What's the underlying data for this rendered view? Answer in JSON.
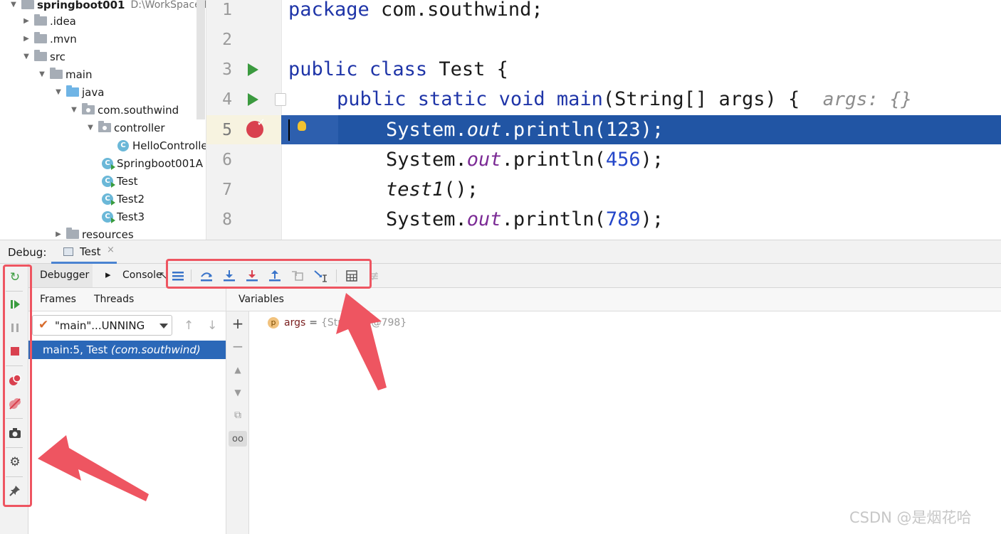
{
  "project": {
    "root_label": "springboot001",
    "root_path": "D:\\WorkSpace\\Id",
    "items": [
      {
        "label": ".idea",
        "kind": "folder"
      },
      {
        "label": ".mvn",
        "kind": "folder"
      },
      {
        "label": "src",
        "kind": "folder"
      },
      {
        "label": "main",
        "kind": "folder"
      },
      {
        "label": "java",
        "kind": "source-folder"
      },
      {
        "label": "com.southwind",
        "kind": "package"
      },
      {
        "label": "controller",
        "kind": "package"
      },
      {
        "label": "HelloControlle",
        "kind": "class"
      },
      {
        "label": "Springboot001A",
        "kind": "class"
      },
      {
        "label": "Test",
        "kind": "class"
      },
      {
        "label": "Test2",
        "kind": "class"
      },
      {
        "label": "Test3",
        "kind": "class"
      },
      {
        "label": "resources",
        "kind": "folder"
      }
    ]
  },
  "editor": {
    "line_numbers": [
      "1",
      "2",
      "3",
      "4",
      "5",
      "6",
      "7",
      "8"
    ],
    "line1": {
      "kw": "package",
      "rest": " com.southwind;"
    },
    "line3": {
      "kw1": "public",
      "kw2": "class",
      "rest": " Test {"
    },
    "line4": {
      "kw": "public static void",
      "name": " main",
      "rest": "(String[] args) {",
      "hint": "args: {}"
    },
    "line5": {
      "pre": "System.",
      "field": "out",
      "call": ".println(",
      "num": "123",
      "post": ");"
    },
    "line6": {
      "pre": "System.",
      "field": "out",
      "call": ".println(",
      "num": "456",
      "post": ");"
    },
    "line7": {
      "call": "test1",
      "post": "();"
    },
    "line8": {
      "pre": "System.",
      "field": "out",
      "call": ".println(",
      "num": "789",
      "post": ");"
    },
    "current_line": "5"
  },
  "debug": {
    "label": "Debug:",
    "run_tab": "Test",
    "close_glyph": "×",
    "tabs": {
      "debugger": "Debugger",
      "console": "Console"
    },
    "toolbar_icons": [
      "show-execution-point-icon",
      "step-over-icon",
      "step-into-icon",
      "force-step-into-icon",
      "step-out-icon",
      "drop-frame-icon",
      "run-to-cursor-icon",
      "evaluate-expression-icon",
      "trace-icon"
    ],
    "left_toolbar_icons": [
      "rerun-icon",
      "resume-icon",
      "pause-icon",
      "stop-icon",
      "view-breakpoints-icon",
      "mute-breakpoints-icon",
      "camera-icon",
      "settings-icon",
      "pin-icon"
    ],
    "frames_header": "Frames",
    "threads_header": "Threads",
    "variables_header": "Variables",
    "thread_select": "\"main\"...UNNING",
    "frame": {
      "text": "main:5, Test ",
      "pkg": "(com.southwind)"
    },
    "variable": {
      "icon": "p",
      "name": "args",
      "eq": "=",
      "value": "{String[0]@798}"
    }
  },
  "watermark": "CSDN @是烟花哈",
  "colors": {
    "highlight": "#2155a4",
    "annotation": "#ee5561",
    "keyword": "#1f35a8",
    "number": "#2446c9",
    "field": "#7b2b95"
  }
}
